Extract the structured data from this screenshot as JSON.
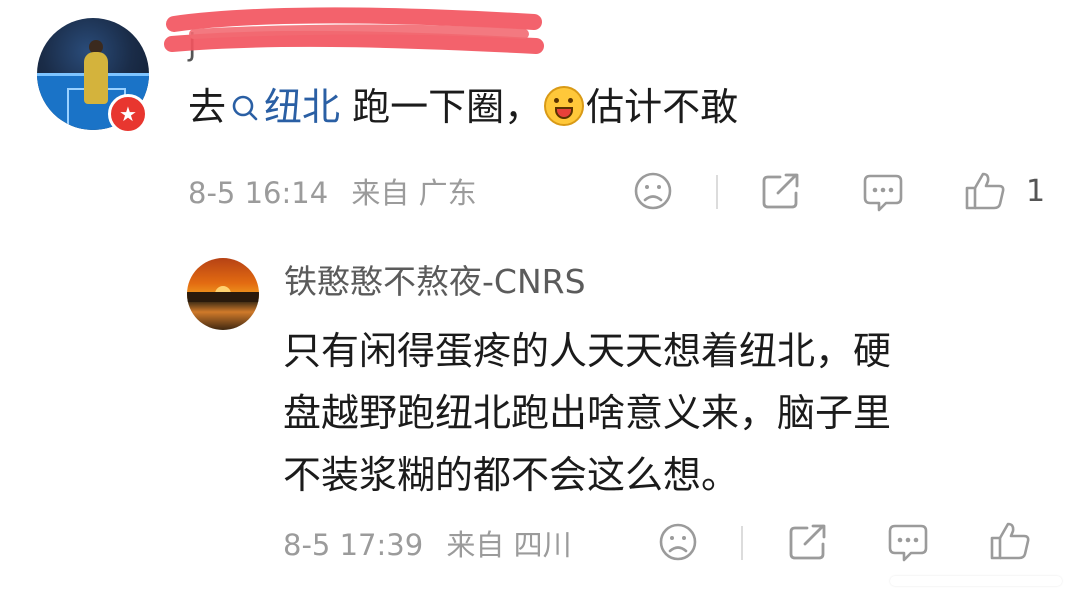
{
  "comment1": {
    "name_visible": "j",
    "body_parts": [
      "去",
      "纽北",
      " 跑一下圈，",
      "估计不敢"
    ],
    "topic_icon": "search-icon",
    "emoji_icon": "laughing-emoji-icon",
    "badge_icon": "star-badge-icon",
    "date_time": "8-5 16:14",
    "location": "来自 广东",
    "like_count": "1"
  },
  "comment2": {
    "name": "铁憨憨不熬夜-CNRS",
    "body_lines": [
      "只有闲得蛋疼的人天天想着纽北，硬",
      "盘越野跑纽北跑出啥意义来，脑子里",
      "不装浆糊的都不会这么想。"
    ],
    "date_time": "8-5 17:39",
    "location": "来自 四川"
  },
  "actions": {
    "dislike_icon": "frown-face-icon",
    "share_icon": "share-icon",
    "reply_icon": "comment-bubble-icon",
    "like_icon": "thumbs-up-icon"
  },
  "colors": {
    "topic_link": "#2a5fa4",
    "meta_text": "#9b9b9b",
    "redaction": "#f2555f",
    "badge": "#e8362f"
  }
}
